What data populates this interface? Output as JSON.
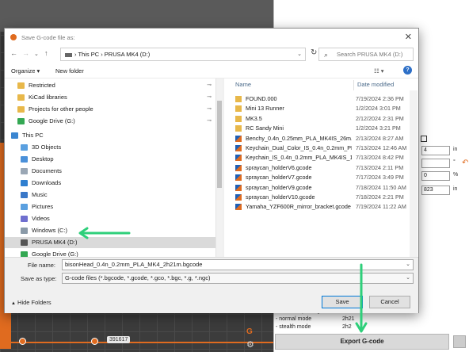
{
  "dialog": {
    "title": "Save G-code file as:",
    "address": "›  This PC  ›  PRUSA MK4 (D:)",
    "search_placeholder": "Search PRUSA MK4 (D:)",
    "organize": "Organize ▾",
    "new_folder": "New folder",
    "nav_items": [
      {
        "label": "Restricted",
        "icon": "folder-icon",
        "color": "#e8b84a",
        "pinned": true
      },
      {
        "label": "KiCad libraries",
        "icon": "folder-icon",
        "color": "#e8b84a",
        "pinned": true
      },
      {
        "label": "Projects for other people",
        "icon": "folder-icon",
        "color": "#e8b84a",
        "pinned": true
      },
      {
        "label": "Google Drive (G:)",
        "icon": "google-drive-icon",
        "color": "#34a853",
        "pinned": true
      },
      {
        "label": "This PC",
        "icon": "pc-icon",
        "color": "#3b86d1",
        "pinned": false
      },
      {
        "label": "3D Objects",
        "icon": "3d-objects-icon",
        "color": "#5aa0e0",
        "pinned": false
      },
      {
        "label": "Desktop",
        "icon": "desktop-icon",
        "color": "#4a90d9",
        "pinned": false
      },
      {
        "label": "Documents",
        "icon": "documents-icon",
        "color": "#9aa7b5",
        "pinned": false
      },
      {
        "label": "Downloads",
        "icon": "downloads-icon",
        "color": "#2f7fd0",
        "pinned": false
      },
      {
        "label": "Music",
        "icon": "music-icon",
        "color": "#3a78c8",
        "pinned": false
      },
      {
        "label": "Pictures",
        "icon": "pictures-icon",
        "color": "#5aa0e0",
        "pinned": false
      },
      {
        "label": "Videos",
        "icon": "videos-icon",
        "color": "#6f6fcf",
        "pinned": false
      },
      {
        "label": "Windows (C:)",
        "icon": "drive-icon",
        "color": "#8a9aa8",
        "pinned": false
      },
      {
        "label": "PRUSA MK4 (D:)",
        "icon": "usb-drive-icon",
        "color": "#555555",
        "pinned": false
      },
      {
        "label": "Google Drive (G:)",
        "icon": "google-drive-icon",
        "color": "#34a853",
        "pinned": false
      }
    ],
    "columns": {
      "name": "Name",
      "date": "Date modified"
    },
    "files": [
      {
        "name": "FOUND.000",
        "date": "7/19/2024 2:36 PM",
        "type": "folder"
      },
      {
        "name": "Mini 13 Runner",
        "date": "1/2/2024 3:01 PM",
        "type": "folder"
      },
      {
        "name": "MK3.5",
        "date": "2/12/2024 2:31 PM",
        "type": "folder"
      },
      {
        "name": "RC Sandy Mini",
        "date": "1/2/2024 3:21 PM",
        "type": "folder"
      },
      {
        "name": "Benchy_0.4n_0.25mm_PLA_MK4IS_26m.g...",
        "date": "2/13/2024 8:27 AM",
        "type": "gcode"
      },
      {
        "name": "Keychain_Dual_Color_IS_0.4n_0.2mm_PL...",
        "date": "7/13/2024 12:46 AM",
        "type": "gcode"
      },
      {
        "name": "Keychain_IS_0.4n_0.2mm_PLA_MK4IS_10...",
        "date": "7/13/2024 8:42 PM",
        "type": "gcode"
      },
      {
        "name": "spraycan_holderV6.gcode",
        "date": "7/13/2024 2:11 PM",
        "type": "gcode"
      },
      {
        "name": "spraycan_holderV7.gcode",
        "date": "7/17/2024 3:49 PM",
        "type": "gcode"
      },
      {
        "name": "spraycan_holderV9.gcode",
        "date": "7/18/2024 11:50 AM",
        "type": "gcode"
      },
      {
        "name": "spraycan_holderV10.gcode",
        "date": "7/18/2024 2:21 PM",
        "type": "gcode"
      },
      {
        "name": "Yamaha_YZF600R_mirror_bracket.gcode",
        "date": "7/19/2024 11:22 AM",
        "type": "gcode"
      }
    ],
    "file_name_label": "File name:",
    "file_name_value": "bisonHead_0.4n_0.2mm_PLA_MK4_2h21m.bgcode",
    "save_type_label": "Save as type:",
    "save_type_value": "G-code files (*.bgcode, *.gcode, *.gco, *.bgc, *.g, *.ngc)",
    "hide_folders": "Hide Folders",
    "save": "Save",
    "cancel": "Cancel"
  },
  "app": {
    "slider_value": "391617",
    "field_values": [
      "4",
      "0",
      "823"
    ],
    "units": [
      "in",
      "°",
      "%",
      "in"
    ],
    "stats_title": "Estimated printing time:",
    "normal_mode": "- normal mode",
    "normal_time": "2h21",
    "stealth_mode": "- stealth mode",
    "stealth_time": "2h2",
    "export_label": "Export G-code"
  },
  "colors": {
    "annotation": "#2ecf7a",
    "accent": "#e06b1f",
    "folder": "#e8b84a"
  }
}
